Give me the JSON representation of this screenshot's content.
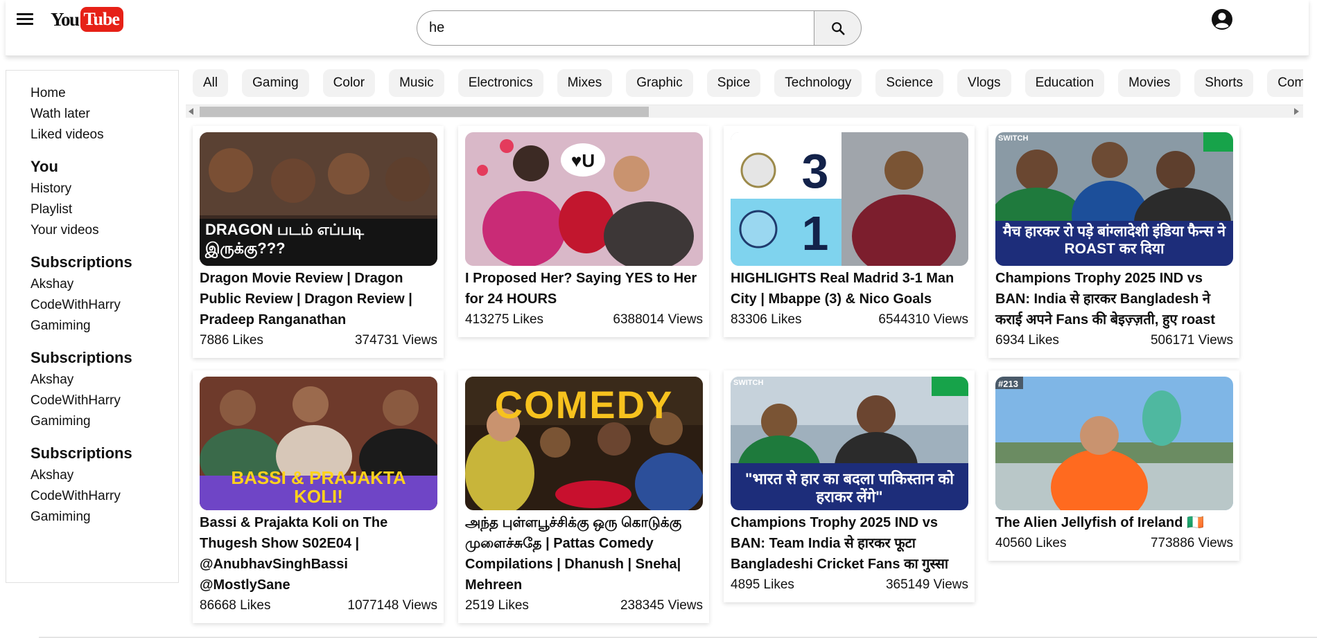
{
  "header": {
    "logo_you": "You",
    "logo_tube": "Tube",
    "search_value": "he"
  },
  "sidebar": {
    "top_items": [
      "Home",
      "Wath later",
      "Liked videos"
    ],
    "you": {
      "heading": "You",
      "items": [
        "History",
        "Playlist",
        "Your videos"
      ]
    },
    "subscriptions": [
      {
        "heading": "Subscriptions",
        "items": [
          "Akshay",
          "CodeWithHarry",
          "Gamiming"
        ]
      },
      {
        "heading": "Subscriptions",
        "items": [
          "Akshay",
          "CodeWithHarry",
          "Gamiming"
        ]
      },
      {
        "heading": "Subscriptions",
        "items": [
          "Akshay",
          "CodeWithHarry",
          "Gamiming"
        ]
      }
    ]
  },
  "chips": [
    "All",
    "Gaming",
    "Color",
    "Music",
    "Electronics",
    "Mixes",
    "Graphic",
    "Spice",
    "Technology",
    "Science",
    "Vlogs",
    "Education",
    "Movies",
    "Shorts",
    "Comedy"
  ],
  "videos": [
    {
      "title": "Dragon Movie Review | Dragon Public Review | Dragon Review | Pradeep Ranganathan",
      "likes": "7886 Likes",
      "views": "374731 Views",
      "thumb_text": "DRAGON படம் எப்படி இருக்கு???",
      "thumb_badge": ""
    },
    {
      "title": "I Proposed Her? Saying YES to Her for 24 HOURS",
      "likes": "413275 Likes",
      "views": "6388014 Views",
      "thumb_text": "",
      "thumb_badge": ""
    },
    {
      "title": "HIGHLIGHTS Real Madrid 3-1 Man City | Mbappe (3) & Nico Goals",
      "likes": "83306 Likes",
      "views": "6544310 Views",
      "thumb_text": "3 1",
      "thumb_badge": ""
    },
    {
      "title": "Champions Trophy 2025 IND vs BAN: India से हारकर Bangladesh ने कराई अपने Fans की बेइज़्ज़ती, हुए roast",
      "likes": "6934 Likes",
      "views": "506171 Views",
      "thumb_text": "मैच हारकर रो पड़े बांग्लादेशी इंडिया फैन्स ने ROAST कर दिया",
      "thumb_badge": "SWITCH"
    },
    {
      "title": "Bassi & Prajakta Koli on The Thugesh Show S02E04 | @AnubhavSinghBassi @MostlySane",
      "likes": "86668 Likes",
      "views": "1077148 Views",
      "thumb_text": "BASSI & PRAJAKTA KOLI!",
      "thumb_badge": ""
    },
    {
      "title": "அந்த புள்ளபூச்சிக்கு ஒரு கொடுக்கு முளைச்சுதே | Pattas Comedy Compilations | Dhanush | Sneha| Mehreen",
      "likes": "2519 Likes",
      "views": "238345 Views",
      "thumb_text": "COMEDY",
      "thumb_badge": ""
    },
    {
      "title": "Champions Trophy 2025 IND vs BAN: Team India से हारकर फूटा Bangladeshi Cricket Fans का गुस्सा",
      "likes": "4895 Likes",
      "views": "365149 Views",
      "thumb_text": "\"भारत से हार का बदला पाकिस्तान को हराकर लेंगे\"",
      "thumb_badge": "SWITCH"
    },
    {
      "title": "The Alien Jellyfish of Ireland 🇮🇪",
      "likes": "40560 Likes",
      "views": "773886 Views",
      "thumb_text": "",
      "thumb_badge": "#213"
    }
  ],
  "colors": {
    "logo_red": "#e62117",
    "chip_bg": "#f2f2f2",
    "scroll_thumb": "#c1c1c1"
  },
  "icons": {
    "menu": "hamburger-menu-icon",
    "search": "magnifier-icon",
    "account": "account-circle-icon"
  }
}
